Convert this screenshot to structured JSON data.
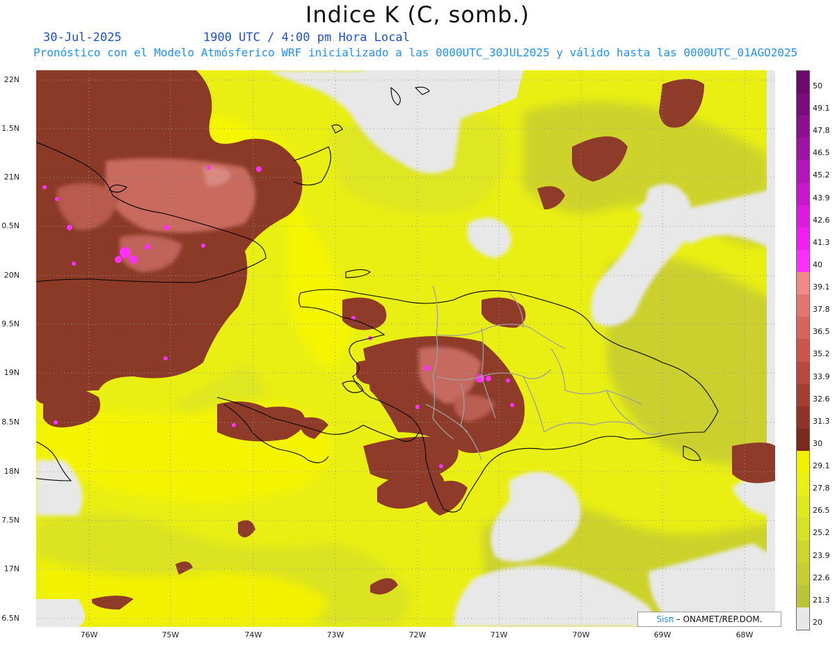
{
  "header": {
    "title": "Indice K (C, somb.)",
    "date": "30-Jul-2025",
    "time": "1900 UTC / 4:00 pm Hora Local",
    "description": "Pronóstico con el Modelo Atmósferico WRF inicializado a las 0000UTC_30JUL2025 y válido hasta las  0000UTC_01AGO2025"
  },
  "axes": {
    "lat_labels": [
      "22N",
      "1.5N",
      "21N",
      "0.5N",
      "20N",
      "9.5N",
      "19N",
      "8.5N",
      "18N",
      "7.5N",
      "17N",
      "6.5N"
    ],
    "lon_labels": [
      "76W",
      "75W",
      "74W",
      "73W",
      "72W",
      "71W",
      "70W",
      "69W",
      "68W"
    ]
  },
  "legend": {
    "labels": [
      "50",
      "49.1",
      "47.8",
      "46.5",
      "45.2",
      "43.9",
      "42.6",
      "41.3",
      "40",
      "39.1",
      "37.8",
      "36.5",
      "35.2",
      "33.9",
      "32.6",
      "31.3",
      "30",
      "29.1",
      "27.8",
      "26.5",
      "25.2",
      "23.9",
      "22.6",
      "21.3",
      "20"
    ],
    "colors": [
      "#6b0a6b",
      "#7a0c7e",
      "#8c0f90",
      "#9e12a4",
      "#b215b8",
      "#c818cc",
      "#dc1bdf",
      "#f01ef2",
      "#ff30ff",
      "#f08a86",
      "#e47670",
      "#d8645e",
      "#cc554e",
      "#b64a40",
      "#a23e32",
      "#8f3426",
      "#7a2a1c",
      "#f2f200",
      "#eaf016",
      "#dfe920",
      "#d6e128",
      "#ccd830",
      "#c3cf34",
      "#bac638",
      "#e8e8e8"
    ]
  },
  "credit": {
    "logo": "Sisπ",
    "text": "– ONAMET/REP.DOM."
  },
  "map_colors": {
    "land_outline": "#000000",
    "province_lines": "#a0a0a0",
    "no_data": "#e8e8e8"
  }
}
